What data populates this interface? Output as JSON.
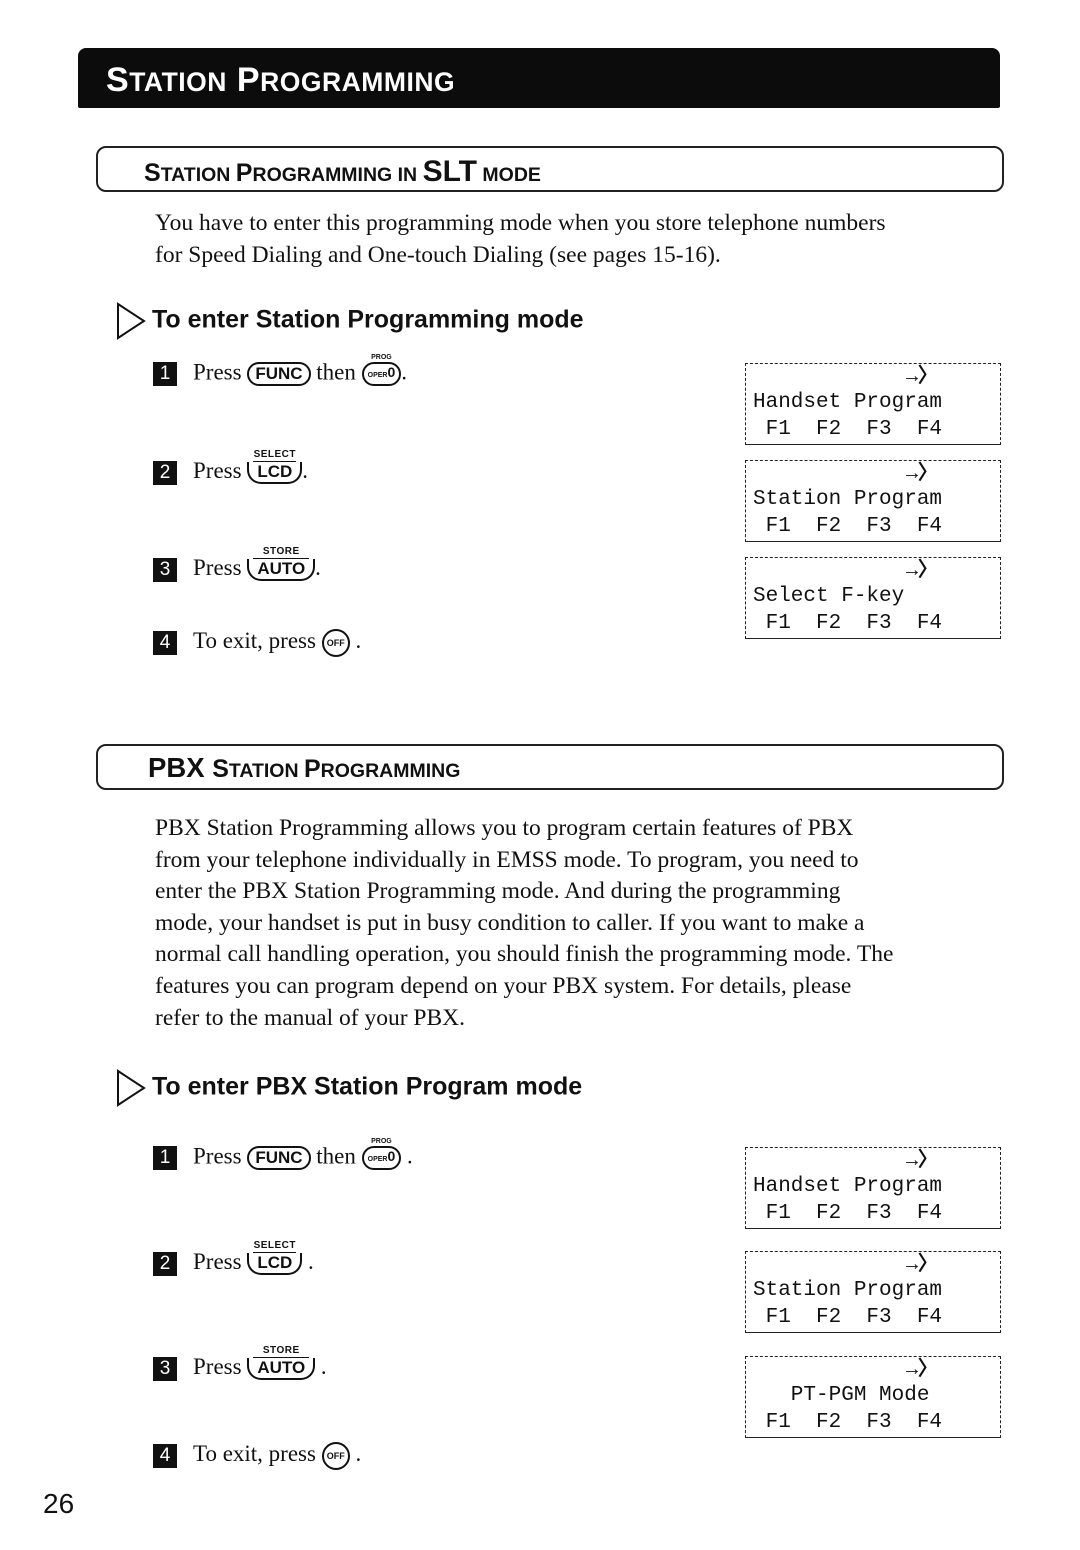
{
  "page_title": {
    "first_initial": "S",
    "first_rest": "TATION",
    "second_initial": "P",
    "second_rest": "ROGRAMMING"
  },
  "sections": [
    {
      "heading": {
        "parts": [
          "S",
          "TATION ",
          "P",
          "ROGRAMMING IN ",
          "SLT",
          " MODE"
        ]
      },
      "paragraph_lines": [
        "You have to enter this programming mode when you store telephone numbers",
        "for Speed Dialing and One-touch Dialing (see pages 15-16)."
      ],
      "subheading": "To enter Station Programming mode",
      "steps": [
        {
          "number": "1",
          "prefix": "Press",
          "key1": "FUNC",
          "middle": "then",
          "key2_label": "PROG",
          "key2_small": "OPER",
          "key2_main": "0",
          "suffix": "."
        },
        {
          "number": "2",
          "prefix": "Press",
          "key_label": "SELECT",
          "key_main": "LCD",
          "suffix": "."
        },
        {
          "number": "3",
          "prefix": "Press",
          "key_label": "STORE",
          "key_main": "AUTO",
          "suffix": "."
        },
        {
          "number": "4",
          "prefix": "To exit, press",
          "key_main": "OFF",
          "suffix": "."
        }
      ],
      "lcd_screens": [
        {
          "arrow": "→〉",
          "line1": "Handset Program",
          "line2": " F1  F2  F3  F4"
        },
        {
          "arrow": "→〉",
          "line1": "Station Program",
          "line2": " F1  F2  F3  F4"
        },
        {
          "arrow": "→〉",
          "line1": "Select F-key",
          "line2": " F1  F2  F3  F4"
        }
      ]
    },
    {
      "heading": {
        "parts": [
          "PBX ",
          "S",
          "TATION ",
          "P",
          "ROGRAMMING"
        ]
      },
      "paragraph_lines": [
        "PBX Station Programming allows you to program certain features of PBX",
        "from your telephone individually in EMSS mode. To program, you need to",
        "enter the PBX Station Programming mode. And during the programming",
        "mode, your handset is put in busy condition to caller. If you want to make a",
        "normal call handling operation, you should finish the programming mode. The",
        "features you can program depend on your PBX system. For details, please",
        "refer to the manual of your PBX."
      ],
      "subheading": "To enter PBX Station Program mode",
      "steps": [
        {
          "number": "1",
          "prefix": "Press",
          "key1": "FUNC",
          "middle": "then",
          "key2_label": "PROG",
          "key2_small": "OPER",
          "key2_main": "0",
          "suffix": "."
        },
        {
          "number": "2",
          "prefix": "Press",
          "key_label": "SELECT",
          "key_main": "LCD",
          "suffix": "."
        },
        {
          "number": "3",
          "prefix": "Press",
          "key_label": "STORE",
          "key_main": "AUTO",
          "suffix": "."
        },
        {
          "number": "4",
          "prefix": "To exit, press",
          "key_main": "OFF",
          "suffix": "."
        }
      ],
      "lcd_screens": [
        {
          "arrow": "→〉",
          "line1": "Handset Program",
          "line2": " F1  F2  F3  F4"
        },
        {
          "arrow": "→〉",
          "line1": "Station Program",
          "line2": " F1  F2  F3  F4"
        },
        {
          "arrow": "→〉",
          "line1": "   PT-PGM Mode",
          "line2": " F1  F2  F3  F4"
        }
      ]
    }
  ],
  "page_number": "26"
}
